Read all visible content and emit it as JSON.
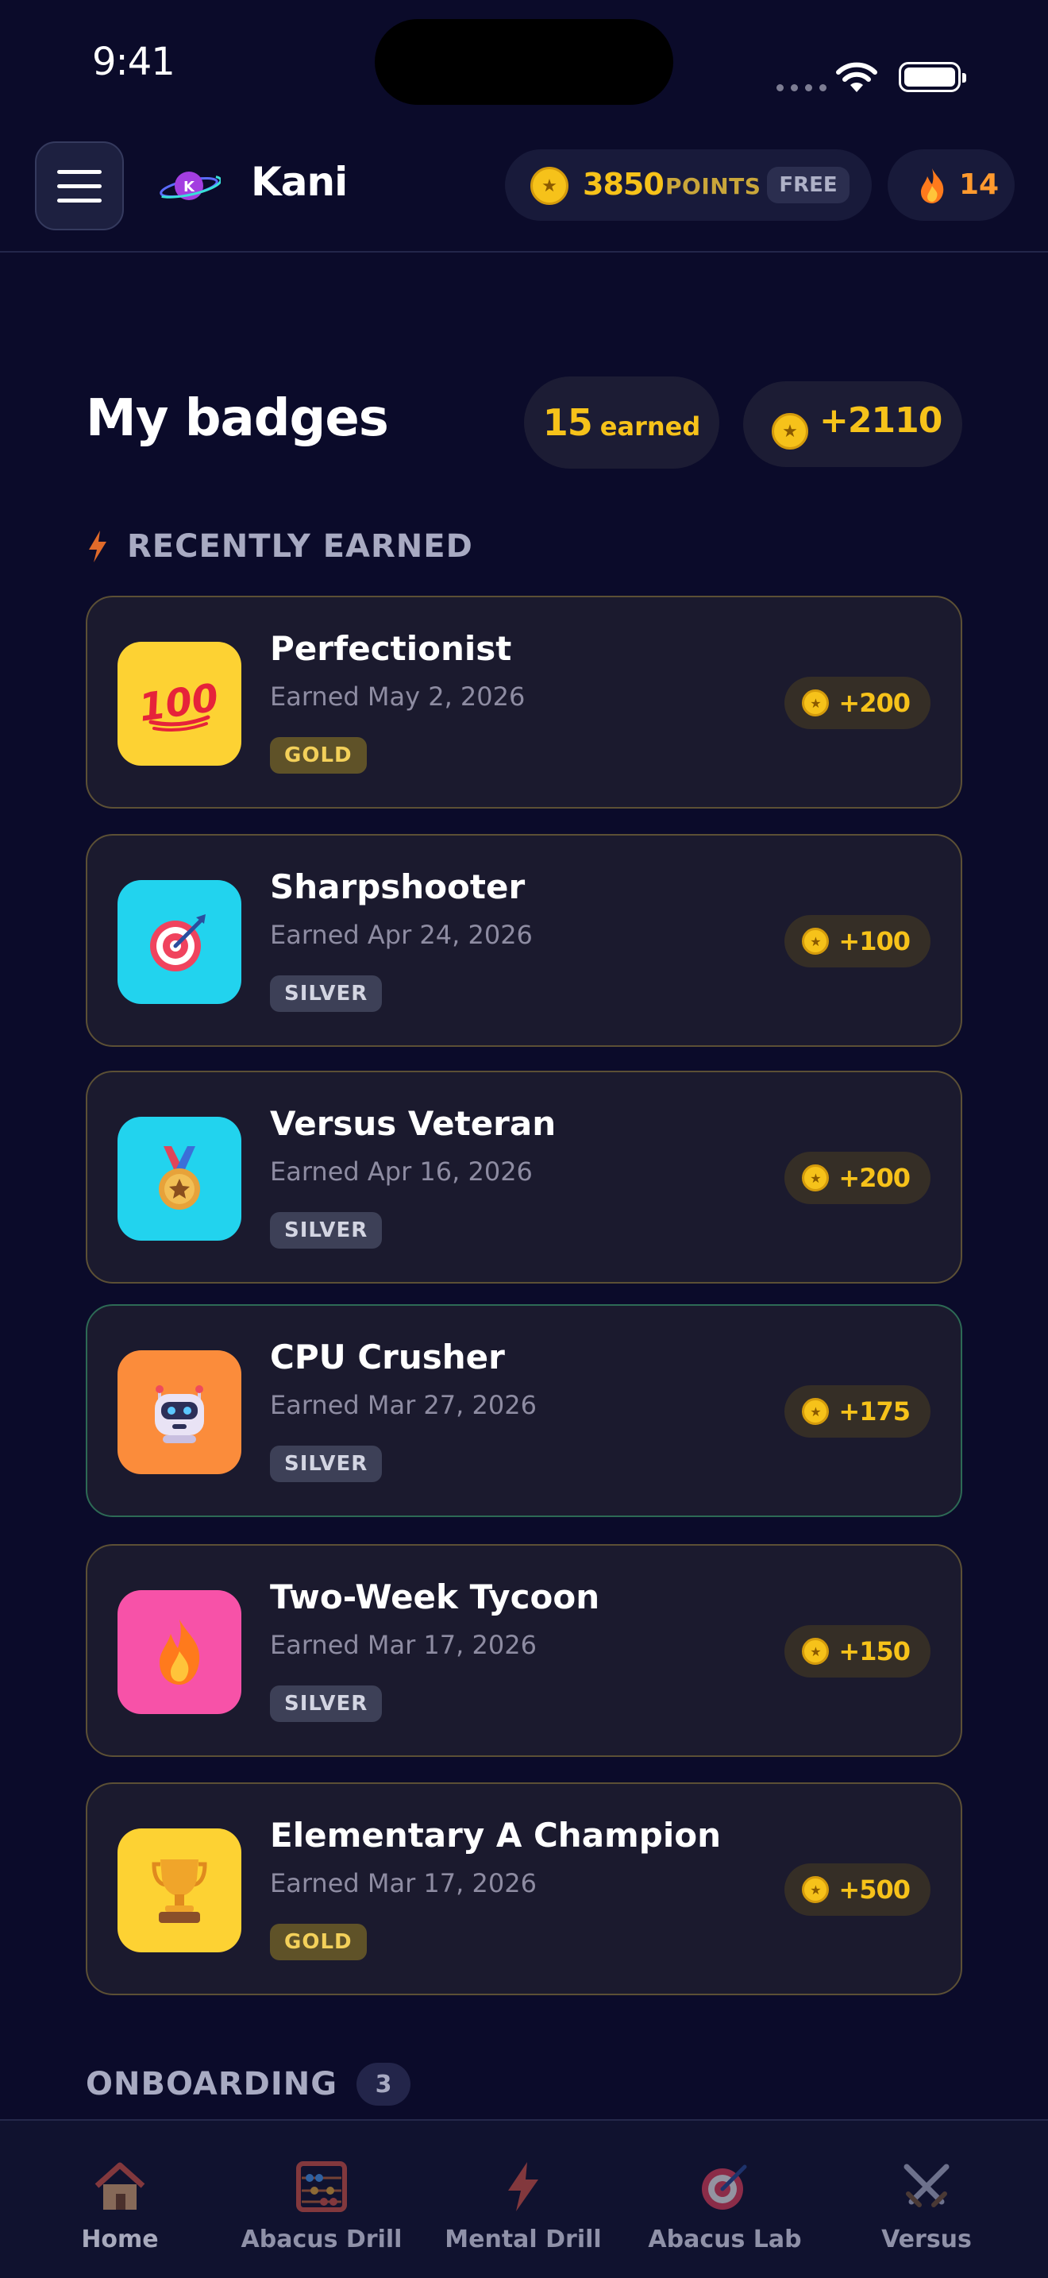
{
  "status_bar": {
    "time": "9:41"
  },
  "header": {
    "app_name": "Kani",
    "logo_letter": "K",
    "points_value": "3850",
    "points_label": "POINTS",
    "plan": "FREE",
    "streak": "14"
  },
  "title_row": {
    "title": "My badges",
    "earned_count": "15",
    "earned_label": "earned",
    "total_points": "+2110"
  },
  "recent_section": {
    "label": "RECENTLY EARNED"
  },
  "badges": [
    {
      "name": "Perfectionist",
      "date": "Earned May 2, 2026",
      "tier": "GOLD",
      "reward": "+200",
      "icon": "hundred-points-icon",
      "color": "#fdd233"
    },
    {
      "name": "Sharpshooter",
      "date": "Earned Apr 24, 2026",
      "tier": "SILVER",
      "reward": "+100",
      "icon": "target-icon",
      "color": "#22d3ee"
    },
    {
      "name": "Versus Veteran",
      "date": "Earned Apr 16, 2026",
      "tier": "SILVER",
      "reward": "+200",
      "icon": "medal-icon",
      "color": "#22d3ee"
    },
    {
      "name": "CPU Crusher",
      "date": "Earned Mar 27, 2026",
      "tier": "SILVER",
      "reward": "+175",
      "icon": "robot-icon",
      "color": "#fb8c3b"
    },
    {
      "name": "Two-Week Tycoon",
      "date": "Earned Mar 17, 2026",
      "tier": "SILVER",
      "reward": "+150",
      "icon": "fire-icon",
      "color": "#f752a8"
    },
    {
      "name": "Elementary A Champion",
      "date": "Earned Mar 17, 2026",
      "tier": "GOLD",
      "reward": "+500",
      "icon": "trophy-icon",
      "color": "#fdd233"
    }
  ],
  "onboarding_section": {
    "label": "ONBOARDING",
    "count": "3"
  },
  "bottom_nav": [
    {
      "label": "Home",
      "icon": "home-icon"
    },
    {
      "label": "Abacus Drill",
      "icon": "abacus-icon"
    },
    {
      "label": "Mental Drill",
      "icon": "lightning-icon"
    },
    {
      "label": "Abacus Lab",
      "icon": "target-icon"
    },
    {
      "label": "Versus",
      "icon": "crossed-swords-icon"
    }
  ]
}
